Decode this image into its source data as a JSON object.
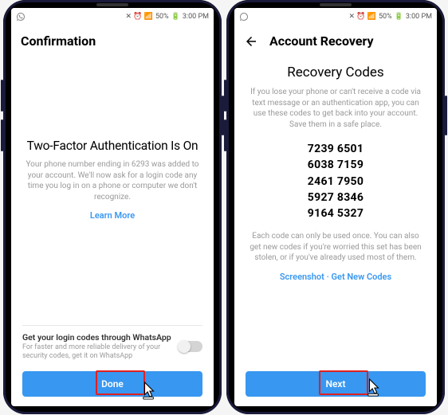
{
  "status": {
    "battery_pct": "50%",
    "time": "3:00 PM",
    "icons_text": "✕ ⏰ ◢"
  },
  "left": {
    "header": "Confirmation",
    "title": "Two-Factor Authentication Is On",
    "desc": "Your phone number ending in 6293 was added to your account. We'll now ask for a login code any time you log in on a phone or computer we don't recognize.",
    "learn_more": "Learn More",
    "wa_title": "Get your login codes through WhatsApp",
    "wa_sub": "For faster and more reliable delivery of your security codes, get it on WhatsApp",
    "done": "Done"
  },
  "right": {
    "header": "Account Recovery",
    "title": "Recovery Codes",
    "desc": "If you lose your phone or can't receive a code via text message or an authentication app, you can use these codes to get back into your account. Save them in a safe place.",
    "codes": [
      "7239 6501",
      "6038 7159",
      "2461 7950",
      "5927 8346",
      "9164 5327"
    ],
    "note": "Each code can only be used once. You can also get new codes if you're worried this set has been stolen, or if you've already used most of them.",
    "screenshot": "Screenshot",
    "get_new": "Get New Codes",
    "next": "Next"
  }
}
